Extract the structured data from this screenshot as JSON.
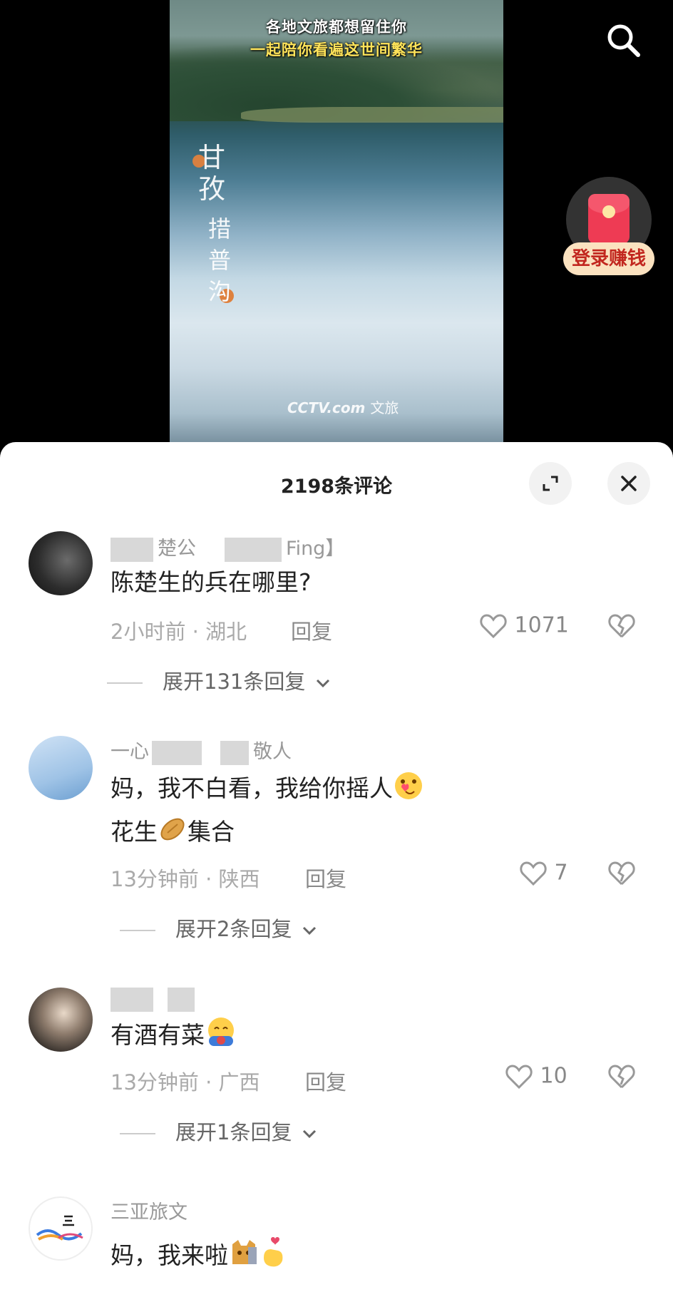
{
  "video": {
    "caption_line1": "各地文旅都想留住你",
    "caption_line2": "一起陪你看遍这世间繁华",
    "brush_text": "甘孜 措普沟",
    "watermark_logo": "CCTV.com",
    "watermark_text": "文旅"
  },
  "promo": {
    "label": "登录赚钱"
  },
  "sheet": {
    "title": "2198条评论"
  },
  "comments": [
    {
      "username_parts": [
        "楚公",
        "Fing】"
      ],
      "text": "陈楚生的兵在哪里?",
      "time": "2小时前 · 湖北",
      "reply_label": "回复",
      "likes": "1071",
      "expand_label": "展开131条回复"
    },
    {
      "username_parts": [
        "一心",
        "敬人"
      ],
      "text_line1": "妈，我不白看，我给你摇人",
      "text_line2_a": "花生",
      "text_line2_b": "集合",
      "time": "13分钟前 · 陕西",
      "reply_label": "回复",
      "likes": "7",
      "expand_label": "展开2条回复"
    },
    {
      "username_parts": [],
      "text": "有酒有菜",
      "time": "13分钟前 · 广西",
      "reply_label": "回复",
      "likes": "10",
      "expand_label": "展开1条回复"
    },
    {
      "username": "三亚旅文",
      "text": "妈，我来啦"
    }
  ],
  "colors": {
    "accent_red": "#ee3b54",
    "promo_bg": "#fbe2c0",
    "promo_text": "#c2271f"
  }
}
